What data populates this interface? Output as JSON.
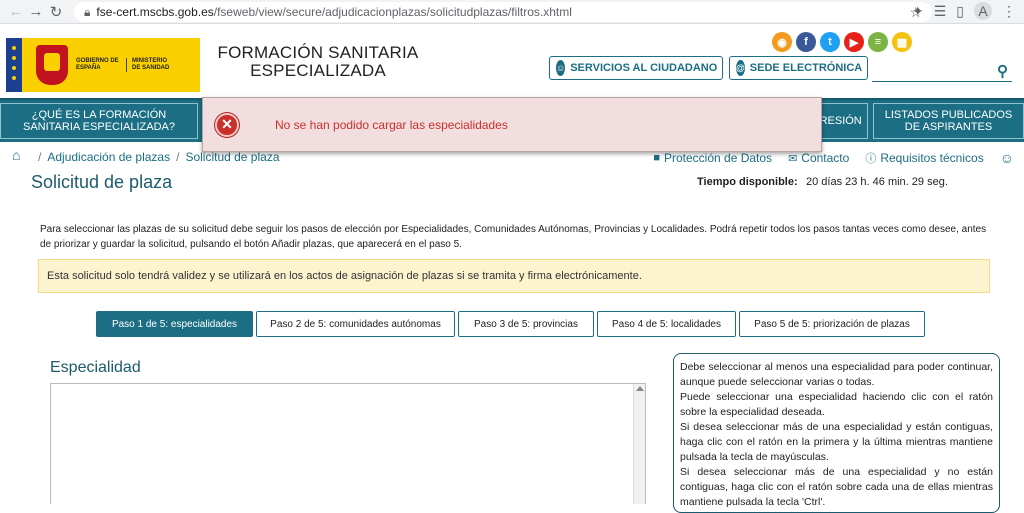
{
  "browser": {
    "url_domain": "fse-cert.mscbs.gob.es",
    "url_path": "/fseweb/view/secure/adjudicacionplazas/solicitudplazas/filtros.xhtml",
    "avatar_letter": "A"
  },
  "header": {
    "gobierno_text": "GOBIERNO DE ESPAÑA",
    "ministerio_text": "MINISTERIO DE SANIDAD",
    "site_title_line1": "FORMACIÓN SANITARIA",
    "site_title_line2": "ESPECIALIZADA",
    "servicios_label": "SERVICIOS AL CIUDADANO",
    "sede_label": "SEDE ELECTRÓNICA",
    "social": [
      {
        "name": "rss-icon",
        "glyph": "◉",
        "color": "#f39b1e"
      },
      {
        "name": "facebook-icon",
        "glyph": "f",
        "color": "#3b5998"
      },
      {
        "name": "twitter-icon",
        "glyph": "t",
        "color": "#1da1f2"
      },
      {
        "name": "youtube-icon",
        "glyph": "▶",
        "color": "#e62117"
      },
      {
        "name": "list-icon",
        "glyph": "≡",
        "color": "#7cb342"
      },
      {
        "name": "calendar-icon",
        "glyph": "▦",
        "color": "#f4c20d"
      }
    ]
  },
  "nav": {
    "item1_line1": "¿QUÉ ES LA FORMACIÓN",
    "item1_line2": "SANITARIA ESPECIALIZADA?",
    "item_partial": "PRESIÓN",
    "item_last_line1": "LISTADOS PUBLICADOS",
    "item_last_line2": "DE ASPIRANTES"
  },
  "error": {
    "message": "No se han podido cargar las especialidades"
  },
  "breadcrumb": {
    "item1": "Adjudicación de plazas",
    "item2": "Solicitud de plaza",
    "separator": "/"
  },
  "top_links": {
    "proteccion": "Protección de Datos",
    "contacto": "Contacto",
    "requisitos": "Requisitos técnicos"
  },
  "page": {
    "title": "Solicitud de plaza",
    "time_label": "Tiempo disponible:",
    "time_value": "20 días 23 h. 46 min. 29 seg.",
    "intro_line1": "Para seleccionar las plazas de su solicitud debe seguir los pasos de elección por Especialidades, Comunidades Autónomas, Provincias y Localidades. Podrá repetir todos los pasos tantas veces como desee, antes",
    "intro_line2": "de priorizar y guardar la solicitud, pulsando el botón Añadir plazas, que aparecerá en el paso 5.",
    "warning": "Esta solicitud solo tendrá validez y se utilizará en los actos de asignación de plazas si se tramita y firma electrónicamente."
  },
  "steps": [
    {
      "label": "Paso 1 de 5: especialidades"
    },
    {
      "label": "Paso 2 de 5: comunidades autónomas"
    },
    {
      "label": "Paso 3 de 5: provincias"
    },
    {
      "label": "Paso 4 de 5: localidades"
    },
    {
      "label": "Paso 5 de 5: priorización de plazas"
    }
  ],
  "especialidad": {
    "title": "Especialidad"
  },
  "help": {
    "p1": "Debe seleccionar al menos una especialidad para poder continuar, aunque puede seleccionar varias o todas.",
    "p2": "Puede seleccionar una especialidad haciendo clic con el ratón sobre la especialidad deseada.",
    "p3": "Si desea seleccionar más de una especialidad y están contiguas, haga clic con el ratón en la primera y la última mientras mantiene pulsada la tecla de mayúsculas.",
    "p4": "Si desea seleccionar más de una especialidad y no están contiguas, haga clic con el ratón sobre cada una de ellas mientras mantiene pulsada la tecla 'Ctrl'."
  }
}
